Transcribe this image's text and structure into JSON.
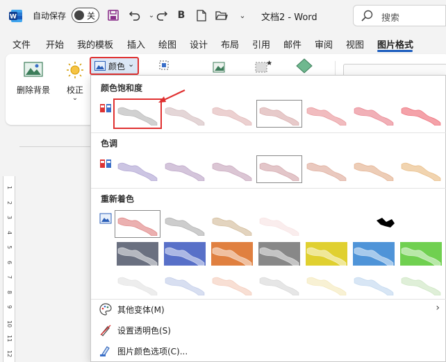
{
  "titlebar": {
    "autosave_label": "自动保存",
    "toggle_state": "关",
    "doc_title": "文档2 - Word",
    "search_placeholder": "搜索",
    "bold_label": "B"
  },
  "tabs": [
    {
      "label": "文件"
    },
    {
      "label": "开始"
    },
    {
      "label": "我的模板"
    },
    {
      "label": "插入"
    },
    {
      "label": "绘图"
    },
    {
      "label": "设计"
    },
    {
      "label": "布局"
    },
    {
      "label": "引用"
    },
    {
      "label": "邮件"
    },
    {
      "label": "审阅"
    },
    {
      "label": "视图"
    },
    {
      "label": "图片格式",
      "active": true
    }
  ],
  "ribbon": {
    "remove_bg_label": "删除背景",
    "correct_label": "校正",
    "correct_arrow": "⌄",
    "color_label": "颜色",
    "color_arrow": "⌄"
  },
  "panel": {
    "saturation_title": "颜色饱和度",
    "tone_title": "色调",
    "recolor_title": "重新着色",
    "menu": {
      "more_variants": "其他变体(M)",
      "set_transparent": "设置透明色(S)",
      "color_options": "图片颜色选项(C)..."
    }
  },
  "ruler_numbers": [
    "1",
    "2",
    "3",
    "4",
    "5",
    "6",
    "7",
    "8",
    "9",
    "10",
    "11",
    "12"
  ],
  "colors": {
    "accent": "#185abd",
    "highlight_red": "#e03030",
    "selected_bg": "#dbe7f6"
  },
  "thumbs": {
    "saturation": [
      "#9a9a9a",
      "#c4a4a6",
      "#d49a9a",
      "#c98a8a",
      "#e06a70",
      "#e05060",
      "#e63040"
    ],
    "tone": [
      "#8f7fc0",
      "#a07fb0",
      "#b080a0",
      "#c08088",
      "#d08870",
      "#d89060",
      "#e0a050"
    ],
    "recolor_row1": [
      "#d25050",
      "#909090",
      "#c0a070",
      "#f5d8d8",
      "#ffffff",
      "#000000"
    ],
    "recolor_row2": [
      "#6a7080",
      "#5870c8",
      "#e08040",
      "#888888",
      "#e0d030",
      "#4f94d8",
      "#70d050"
    ],
    "recolor_row3": [
      "#d8d8d8",
      "#a8b8e0",
      "#f0b8a0",
      "#c8c8c8",
      "#f0e0a0",
      "#a8c8e8",
      "#b8dca8"
    ]
  }
}
